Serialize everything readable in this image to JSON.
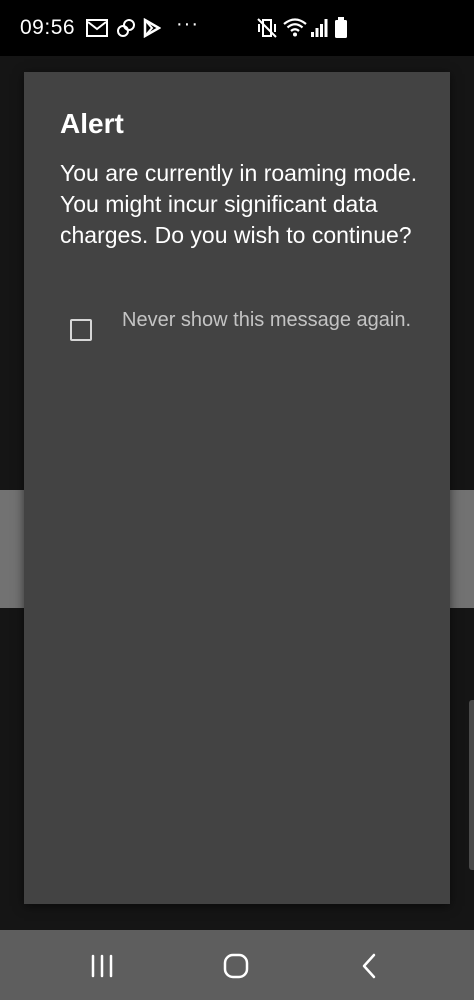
{
  "status_bar": {
    "time": "09:56",
    "more_indicator": "···",
    "left_icons": [
      "gmail-icon",
      "link-icon",
      "play-icon"
    ],
    "right_icons": [
      "vibrate-icon",
      "wifi-icon",
      "signal-icon",
      "battery-icon"
    ]
  },
  "dialog": {
    "title": "Alert",
    "message": "You are currently in roaming mode. You might incur significant data charges. Do you wish to continue?",
    "checkbox": {
      "label": "Never show this message again.",
      "checked": false
    }
  },
  "nav_bar": {
    "buttons": [
      "recents-icon",
      "home-icon",
      "back-icon"
    ]
  },
  "colors": {
    "dialog_bg": "#434343",
    "backdrop": "#151515",
    "nav_bar_bg": "#5e5e5e"
  }
}
